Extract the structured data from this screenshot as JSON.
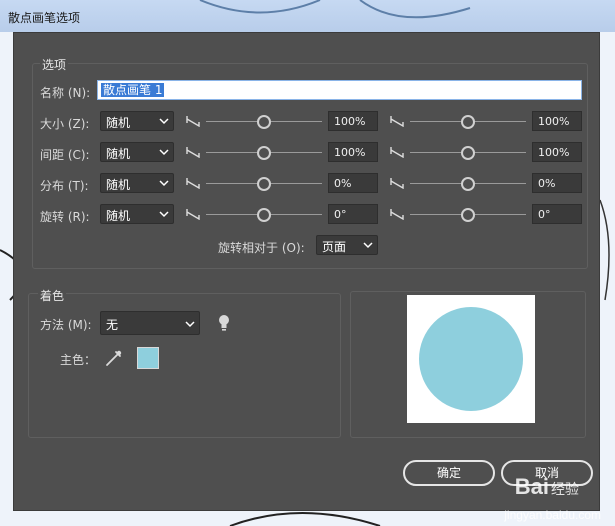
{
  "window": {
    "title": "散点画笔选项"
  },
  "options": {
    "group_title": "选项",
    "name_label": "名称 (N):",
    "name_value": "散点画笔 1",
    "rows": [
      {
        "label": "大小 (Z):",
        "mode": "随机",
        "min_value": "100%",
        "max_value": "100%",
        "min_slider": 0.5,
        "max_slider": 0.5
      },
      {
        "label": "间距 (C):",
        "mode": "随机",
        "min_value": "100%",
        "max_value": "100%",
        "min_slider": 0.5,
        "max_slider": 0.5
      },
      {
        "label": "分布 (T):",
        "mode": "随机",
        "min_value": "0%",
        "max_value": "0%",
        "min_slider": 0.5,
        "max_slider": 0.5
      },
      {
        "label": "旋转 (R):",
        "mode": "随机",
        "min_value": "0°",
        "max_value": "0°",
        "min_slider": 0.5,
        "max_slider": 0.5
      }
    ],
    "rotate_relative_label": "旋转相对于 (O):",
    "rotate_relative_value": "页面"
  },
  "colorization": {
    "group_title": "着色",
    "method_label": "方法 (M):",
    "method_value": "无",
    "key_color_label": "主色：",
    "key_color": "#8ecfdd"
  },
  "preview": {
    "circle_color": "#8ecfdd"
  },
  "buttons": {
    "ok": "确定",
    "cancel": "取消"
  },
  "watermark": {
    "brand": "Bai",
    "brand_suffix": "经验",
    "url": "jingyan.baidu.com"
  },
  "colors": {
    "dialog_bg": "#4f4f4f",
    "selection": "#3a7bd5"
  }
}
